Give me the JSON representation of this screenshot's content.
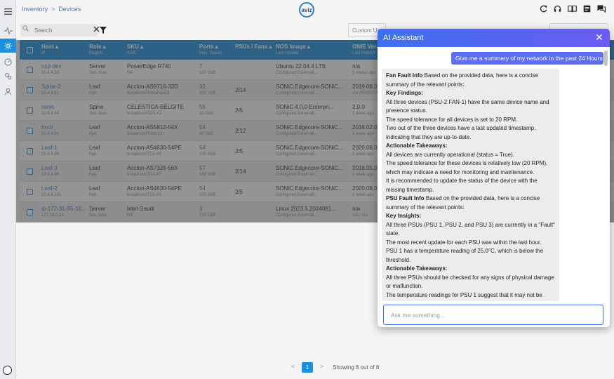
{
  "breadcrumb": {
    "parent": "Inventory",
    "separator": ">",
    "current": "Devices"
  },
  "logo": {
    "text": "aviz"
  },
  "toolbar": {
    "search_placeholder": "Search",
    "custom_label": "Custom Up"
  },
  "table": {
    "columns": [
      {
        "title": "Host",
        "subtitle": "IP"
      },
      {
        "title": "Role",
        "subtitle": "Region"
      },
      {
        "title": "SKU",
        "subtitle": "ASIC"
      },
      {
        "title": "Ports",
        "subtitle": "Max. Speed"
      },
      {
        "title": "PSUs / Fans",
        "subtitle": ""
      },
      {
        "title": "NOS Image",
        "subtitle": "Last Update"
      },
      {
        "title": "ONIE Versi",
        "subtitle": "Last Reboot"
      }
    ],
    "rows": [
      {
        "host": "ncp-dev",
        "ip": "10.4.4.33",
        "role": "Server",
        "region": "San Jose",
        "sku": "PowerEdge R740",
        "asic": "NA",
        "ports": "7",
        "speed": "100 GbE",
        "psus": "",
        "nos": "Ubuntu 22.04.4 LTS",
        "nos_update": "Configured Externall...",
        "onie": "n/a",
        "reboot": "3 weeks ago"
      },
      {
        "host": "Spine-2",
        "ip": "10.4.4.61",
        "role": "Leaf",
        "region": "Nyk",
        "sku": "Accton-AS9716-32D",
        "asic": "broadcom/Tomahawk3",
        "ports": "32",
        "speed": "400 GbE",
        "psus": "2/14",
        "nos": "SONiC.Edgecore-SONiC...",
        "nos_update": "Configured Externall...",
        "onie": "2019.08.00",
        "reboot": "n/a /REBOOT"
      },
      {
        "host": "sonic",
        "ip": "10.4.4.64",
        "role": "Spine",
        "region": "San Jose",
        "sku": "CELESTICA-BELGITE",
        "asic": "broadcom/TD3-X2",
        "ports": "56",
        "speed": "10 GbE",
        "psus": "2/5",
        "nos": "SONiC.4.0.0-Enterpri...",
        "nos_update": "Configured Externall...",
        "onie": "2.0.0",
        "reboot": "1 week ago"
      },
      {
        "host": "fmcli",
        "ip": "10.4.4.94",
        "role": "Leaf",
        "region": "Nyk",
        "sku": "Accton-AS5812-54X",
        "asic": "broadcom/Trident2+",
        "ports": "54",
        "speed": "40 GbE",
        "psus": "2/12",
        "nos": "SONiC.Edgecore-SONiC...",
        "nos_update": "Configured Externall...",
        "onie": "2018.02.00",
        "reboot": "1 week ago"
      },
      {
        "host": "Leaf-1",
        "ip": "10.4.4.96",
        "role": "Leaf",
        "region": "Nyk",
        "sku": "Accton-AS4630-54PE",
        "asic": "broadcom/TD3-X5",
        "ports": "54",
        "speed": "100 GbE",
        "psus": "2/5",
        "nos": "SONiC.Edgecore-SONiC...",
        "nos_update": "Configured Externall...",
        "onie": "2020.08.00",
        "reboot": "1 week ago"
      },
      {
        "host": "Leaf-3",
        "ip": "10.4.4.98",
        "role": "Leaf",
        "region": "Nyk",
        "sku": "Accton-AS7326-56X",
        "asic": "broadcom/TD3-X7",
        "ports": "57",
        "speed": "100 GbE",
        "psus": "2/14",
        "nos": "SONiC.Edgecore-SONiC...",
        "nos_update": "Configured Externall...",
        "onie": "2018.05.00",
        "reboot": "1 week ago"
      },
      {
        "host": "Leaf-2",
        "ip": "10.4.4.101",
        "role": "Leaf",
        "region": "Nyk",
        "sku": "Accton-AS4630-54PE",
        "asic": "broadcom/TD3-X5",
        "ports": "54",
        "speed": "100 GbE",
        "psus": "2/5",
        "nos": "SONiC.Edgecore-SONiC...",
        "nos_update": "Configured Externall...",
        "onie": "2020.08.00",
        "reboot": "1 week ago"
      },
      {
        "host": "ip-172-31-95-18...",
        "ip": "172.18.0.19",
        "role": "Server",
        "region": "San Jose",
        "sku": "Intel Gaudi",
        "asic": "NA",
        "ports": "3",
        "speed": "100 GbE",
        "psus": "",
        "nos": "Linux 2023.5.2024081...",
        "nos_update": "Configured Externall...",
        "onie": "n/a",
        "reboot": "n/a / n/a"
      }
    ]
  },
  "pagination": {
    "prev": "<",
    "page": "1",
    "next": ">",
    "info": "Showing 8 out of 8"
  },
  "assistant": {
    "title": "AI Assistant",
    "close": "✕",
    "user_message": "Give me a summary of my network in the past 24 Hours",
    "response": [
      {
        "bold": "Fan Fault Info",
        "text": " Based on the provided data, here is a concise summary of the relevant points:"
      },
      {
        "bold": "Key Findings:",
        "text": ""
      },
      {
        "bold": "",
        "text": "All three devices (PSU-2 FAN-1) have the same device name and presence status."
      },
      {
        "bold": "",
        "text": "The speed tolerance for all devices is set to 20 RPM."
      },
      {
        "bold": "",
        "text": "Two out of the three devices have a last updated timestamp, indicating that they are up-to-date."
      },
      {
        "bold": "Actionable Takeaways:",
        "text": ""
      },
      {
        "bold": "",
        "text": "All devices are currently operational (status = True)."
      },
      {
        "bold": "",
        "text": "The speed tolerance for these devices is relatively low (20 RPM), which may indicate a need for monitoring and maintenance."
      },
      {
        "bold": "",
        "text": "It is recommended to update the status of the device with the missing timestamp."
      },
      {
        "bold": "PSU Fault Info",
        "text": " Based on the provided data, here is a concise summary of the relevant points:"
      },
      {
        "bold": "Key Insights:",
        "text": ""
      },
      {
        "bold": "",
        "text": "All three PSUs (PSU 1, PSU 2, and PSU 3) are currently in a \"Fault\" state."
      },
      {
        "bold": "",
        "text": "The most recent update for each PSU was within the last hour."
      },
      {
        "bold": "",
        "text": "PSU 1 has a temperature reading of 25.0°C, which is below the threshold."
      },
      {
        "bold": "Actionable Takeaways:",
        "text": ""
      },
      {
        "bold": "",
        "text": "All three PSUs should be checked for any signs of physical damage or malfunction."
      },
      {
        "bold": "",
        "text": "The temperature readings for PSU 1 suggest that it may not be"
      }
    ],
    "input_placeholder": "Ask me something..."
  }
}
